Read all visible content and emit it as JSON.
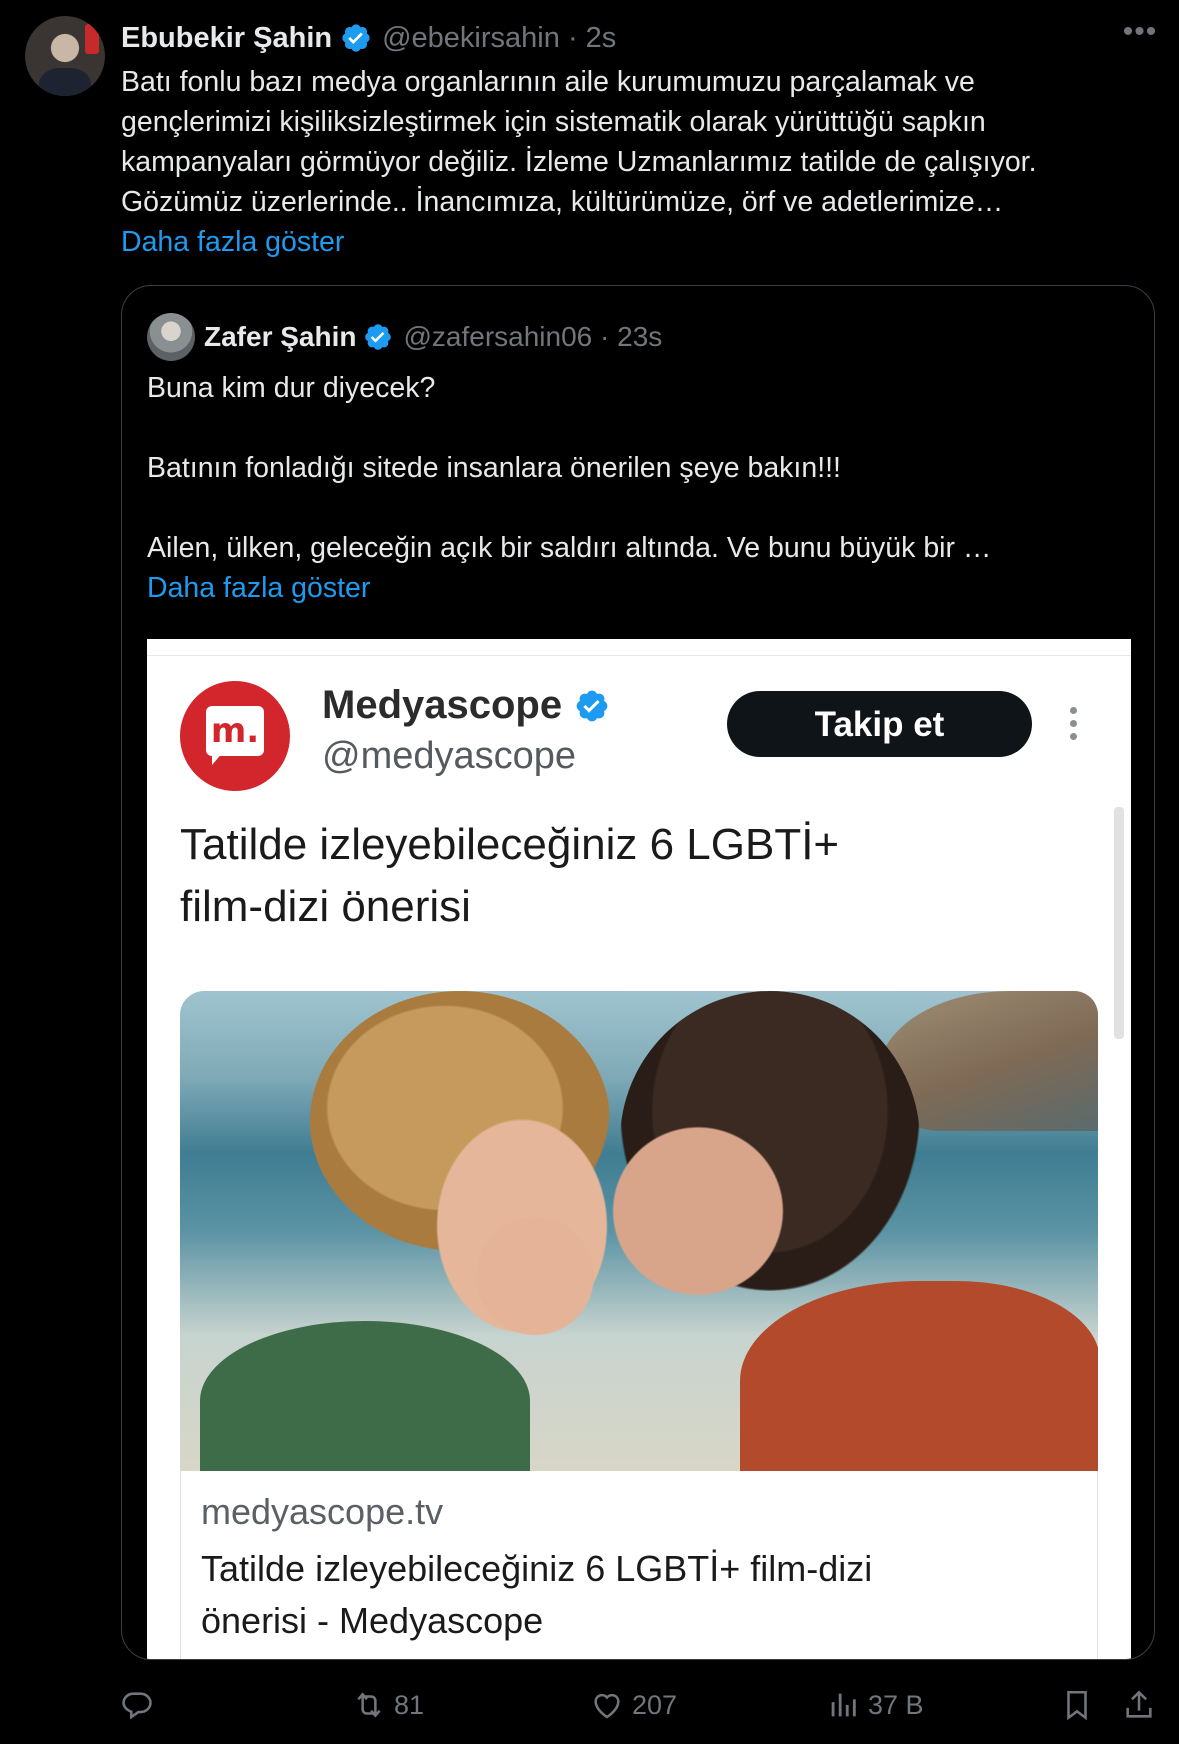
{
  "tweet": {
    "author_name": "Ebubekir Şahin",
    "author_handle": "@ebekirsahin",
    "separator": "·",
    "time": "2s",
    "more_icon": "more-horizontal-icon",
    "text_lines": [
      "Batı fonlu bazı medya organlarının aile kurumumuzu parçalamak ve",
      "gençlerimizi kişiliksizleştirmek için sistematik olarak yürüttüğü sapkın",
      "kampanyaları görmüyor değiliz. İzleme Uzmanlarımız tatilde de çalışıyor.",
      "Gözümüz üzerlerinde.. İnancımıza, kültürümüze, örf ve adetlerimize…"
    ],
    "show_more": "Daha fazla göster"
  },
  "quote": {
    "author_name": "Zafer Şahin",
    "author_handle": "@zafersahin06",
    "separator": "·",
    "time": "23s",
    "text_lines": [
      "Buna kim dur diyecek?",
      "",
      "Batının fonladığı sitede insanlara önerilen şeye bakın!!!",
      "",
      "Ailen, ülken, geleceğin açık bir saldırı altında. Ve bunu büyük bir …"
    ],
    "show_more": "Daha fazla göster"
  },
  "embed": {
    "logo_text": "m.",
    "name": "Medyascope",
    "handle": "@medyascope",
    "follow_label": "Takip et",
    "title_lines": [
      "Tatilde izleyebileceğiniz 6 LGBTİ+",
      "film-dizi önerisi"
    ],
    "link_domain": "medyascope.tv",
    "link_title_lines": [
      "Tatilde izleyebileceğiniz 6 LGBTİ+ film-dizi",
      "önerisi - Medyascope"
    ]
  },
  "actions": {
    "reply_count": "",
    "retweet_count": "81",
    "like_count": "207",
    "views_count": "37 B"
  },
  "colors": {
    "background": "#000000",
    "text": "#e7e9ea",
    "muted": "#71767b",
    "link": "#1d9bf0",
    "verified": "#1d9bf0",
    "brand_red": "#d2262c"
  }
}
